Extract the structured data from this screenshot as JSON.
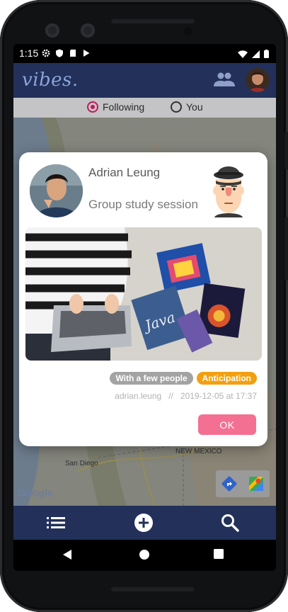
{
  "status_bar": {
    "time": "1:15"
  },
  "app_bar": {
    "logo": "vibes."
  },
  "filter": {
    "options": [
      {
        "label": "Following",
        "selected": true
      },
      {
        "label": "You",
        "selected": false
      }
    ]
  },
  "map": {
    "labels": {
      "san_diego": "San Diego",
      "new_mexico": "NEW MEXICO"
    },
    "attribution": "Google"
  },
  "post_dialog": {
    "username": "Adrian Leung",
    "title": "Group study session",
    "tags": [
      "With a few people",
      "Anticipation"
    ],
    "author_handle": "adrian.leung",
    "separator": "//",
    "timestamp": "2019-12-05 at 17:37",
    "ok_label": "OK"
  },
  "icons": {
    "people": "people-icon",
    "list": "list-icon",
    "add": "add-circle-icon",
    "search": "search-icon",
    "directions": "directions-icon",
    "maps": "google-maps-icon"
  },
  "colors": {
    "app_bar": "#22305a",
    "accent_radio": "#c2185b",
    "ok_button": "#f47092",
    "tag_grey": "#a3a3a3",
    "tag_orange": "#f2a00f"
  }
}
